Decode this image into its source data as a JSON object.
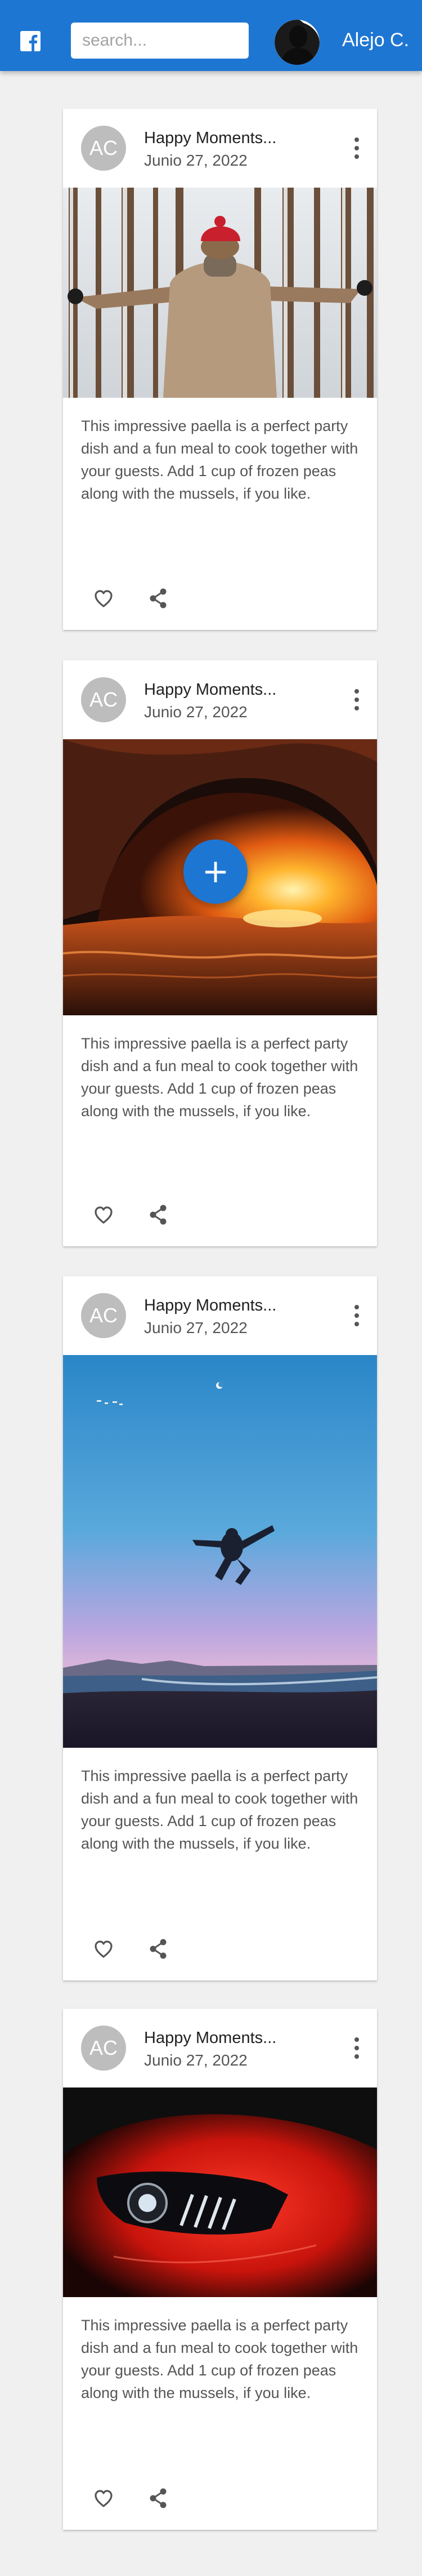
{
  "appbar": {
    "search_placeholder": "search...",
    "user_name": "Alejo C.",
    "brand_color": "#1e76d3"
  },
  "posts": [
    {
      "avatar_initials": "AC",
      "title": "Happy Moments...",
      "date": "Junio 27, 2022",
      "image": "woman-in-snowy-forest",
      "text": "This impressive paella is a perfect party dish and a fun meal to cook together with your guests. Add 1 cup of frozen peas along with the mussels, if you like."
    },
    {
      "avatar_initials": "AC",
      "title": "Happy Moments...",
      "date": "Junio 27, 2022",
      "image": "ocean-wave-at-sunset",
      "text": "This impressive paella is a perfect party dish and a fun meal to cook together with your guests. Add 1 cup of frozen peas along with the mussels, if you like."
    },
    {
      "avatar_initials": "AC",
      "title": "Happy Moments...",
      "date": "Junio 27, 2022",
      "image": "man-jumping-on-beach",
      "text": "This impressive paella is a perfect party dish and a fun meal to cook together with your guests. Add 1 cup of frozen peas along with the mussels, if you like."
    },
    {
      "avatar_initials": "AC",
      "title": "Happy Moments...",
      "date": "Junio 27, 2022",
      "image": "red-car-headlight",
      "text": "This impressive paella is a perfect party dish and a fun meal to cook together with your guests. Add 1 cup of frozen peas along with the mussels, if you like."
    }
  ],
  "fab": {
    "label": "+",
    "icon": "plus-icon"
  }
}
